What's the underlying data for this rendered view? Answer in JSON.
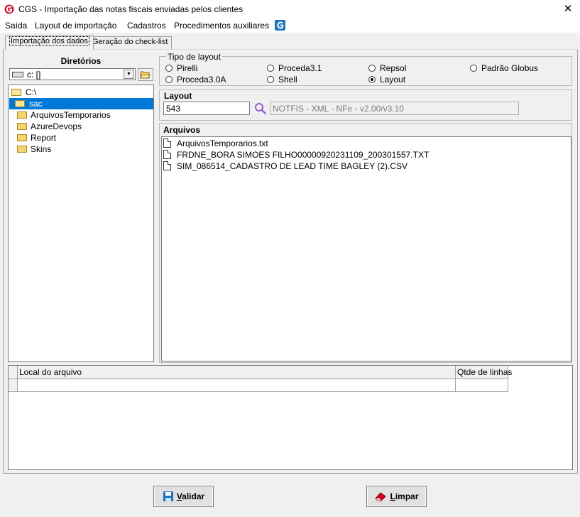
{
  "window": {
    "title": "CGS - Importação das notas fiscais enviadas pelos clientes",
    "close_glyph": "✕",
    "icon": "cgs-logo-icon"
  },
  "menu": [
    {
      "label": "Saída"
    },
    {
      "label": "Layout de importação"
    },
    {
      "label": "Cadastros"
    },
    {
      "label": "Procedimentos auxiliares"
    }
  ],
  "tabs": {
    "active": "Importação dos dados",
    "other": "Geração do check-list"
  },
  "directories": {
    "title": "Diretórios",
    "drive": "c: []",
    "tree": [
      {
        "label": "C:\\",
        "state": "open"
      },
      {
        "label": "sac",
        "state": "open-selected"
      },
      {
        "label": "ArquivosTemporarios",
        "state": "closed"
      },
      {
        "label": "AzureDevops",
        "state": "closed"
      },
      {
        "label": "Report",
        "state": "closed"
      },
      {
        "label": "Skins",
        "state": "closed"
      }
    ]
  },
  "layout_type": {
    "legend": "Tipo de layout",
    "options": [
      {
        "label": "Pirelli",
        "checked": false
      },
      {
        "label": "Proceda3.1",
        "checked": false
      },
      {
        "label": "Repsol",
        "checked": false
      },
      {
        "label": "Padrão Globus",
        "checked": false
      },
      {
        "label": "Proceda3.0A",
        "checked": false
      },
      {
        "label": "Shell",
        "checked": false
      },
      {
        "label": "Layout",
        "checked": true
      }
    ]
  },
  "layout": {
    "title": "Layout",
    "code": "543",
    "description": "NOTFIS - XML - NFe - v2.00/v3.10"
  },
  "files": {
    "title": "Arquivos",
    "items": [
      "ArquivosTemporarios.txt",
      "FRDNE_BORA SIMOES FILHO00000920231109_200301557.TXT",
      "SIM_086514_CADASTRO DE LEAD TIME BAGLEY (2).CSV"
    ]
  },
  "grid": {
    "columns": [
      "Local do arquivo",
      "Qtde de linhas"
    ]
  },
  "buttons": {
    "validate": {
      "label_first": "V",
      "label_rest": "alidar"
    },
    "clear": {
      "label_first": "L",
      "label_rest": "impar"
    }
  },
  "colors": {
    "selection": "#0078d7",
    "accent_red": "#c8102e",
    "accent_blue": "#1e73be"
  }
}
